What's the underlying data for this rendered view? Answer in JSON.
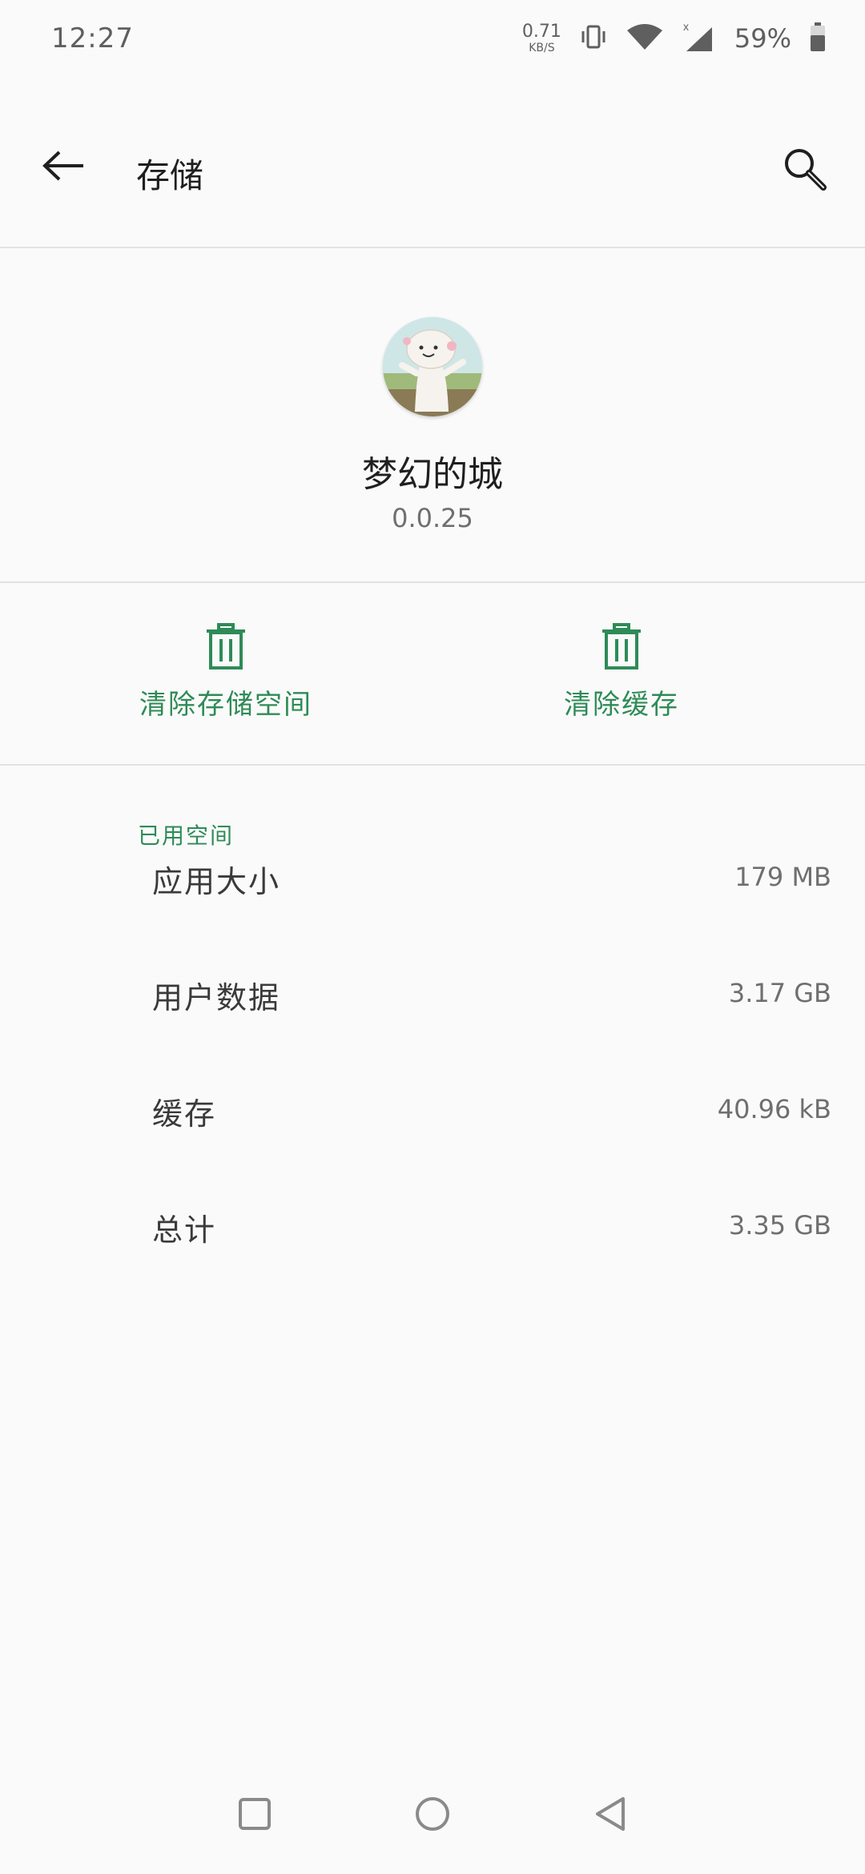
{
  "status_bar": {
    "time": "12:27",
    "net_speed_value": "0.71",
    "net_speed_unit": "KB/S",
    "battery": "59%",
    "icons": [
      "vibrate-icon",
      "wifi-icon",
      "cellular-signal-icon",
      "battery-icon"
    ]
  },
  "toolbar": {
    "title": "存储",
    "back_icon": "arrow-left-icon",
    "search_icon": "search-icon"
  },
  "app": {
    "name": "梦幻的城",
    "version": "0.0.25"
  },
  "actions": {
    "clear_storage_label": "清除存储空间",
    "clear_cache_label": "清除缓存",
    "icon": "trash-icon",
    "accent_color": "#2e8b57"
  },
  "storage": {
    "section_title": "已用空间",
    "rows": [
      {
        "label": "应用大小",
        "value": "179 MB"
      },
      {
        "label": "用户数据",
        "value": "3.17 GB"
      },
      {
        "label": "缓存",
        "value": "40.96 kB"
      },
      {
        "label": "总计",
        "value": "3.35 GB"
      }
    ]
  },
  "nav_bar": {
    "icons": [
      "recents-square-icon",
      "home-circle-icon",
      "back-triangle-icon"
    ]
  }
}
